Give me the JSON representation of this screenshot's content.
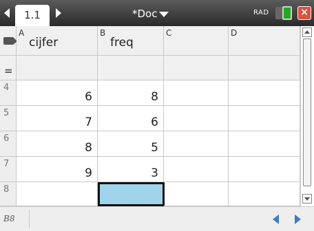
{
  "window": {
    "tab_label": "1.1",
    "doc_title": "*Doc",
    "mode": "RAD",
    "close_label": "×"
  },
  "columns": [
    {
      "letter": "A",
      "name": "cijfer"
    },
    {
      "letter": "B",
      "name": "freq"
    },
    {
      "letter": "C",
      "name": ""
    },
    {
      "letter": "D",
      "name": ""
    }
  ],
  "formula_row_symbol": "=",
  "rows": [
    {
      "num": "4",
      "a": "6",
      "b": "8"
    },
    {
      "num": "5",
      "a": "7",
      "b": "6"
    },
    {
      "num": "6",
      "a": "8",
      "b": "5"
    },
    {
      "num": "7",
      "a": "9",
      "b": "3"
    },
    {
      "num": "8",
      "a": "",
      "b": ""
    }
  ],
  "selected_cell": "B8",
  "colors": {
    "selection": "#9fd4ea",
    "nav_arrow": "#3a7fc1"
  }
}
